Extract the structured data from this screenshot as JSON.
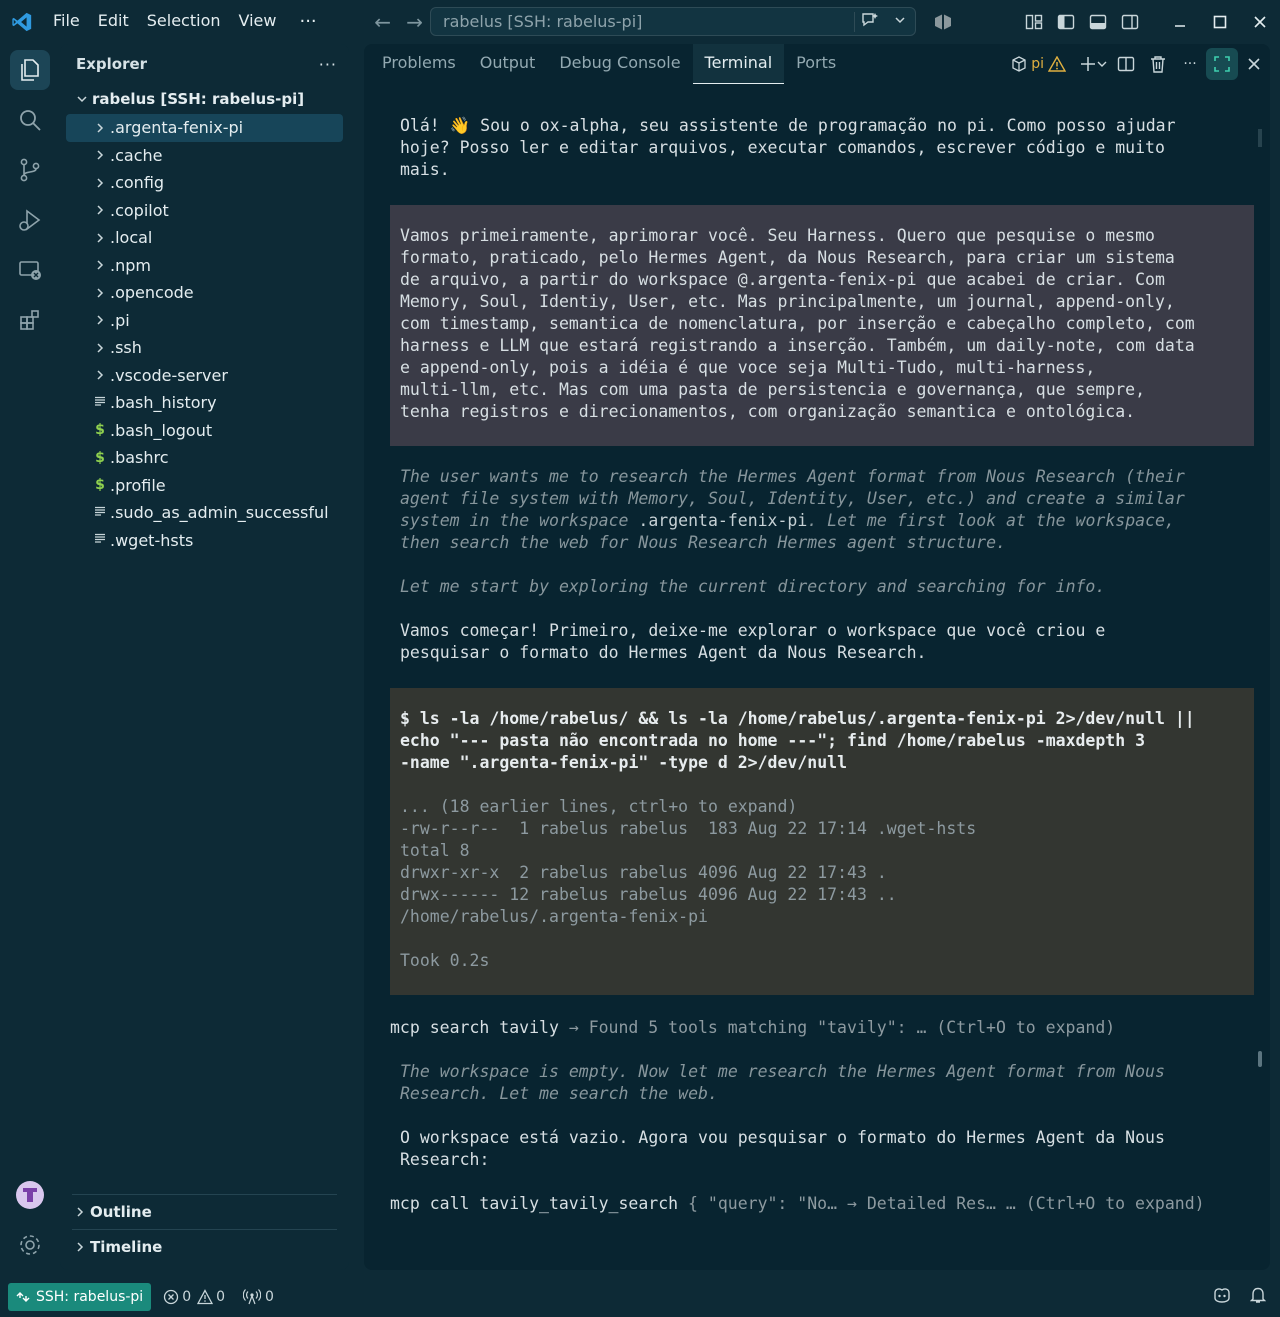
{
  "titlebar": {
    "menus": [
      "File",
      "Edit",
      "Selection",
      "View"
    ],
    "more": "···",
    "command_center": "rabelus [SSH: rabelus-pi]"
  },
  "sidebar": {
    "title": "Explorer",
    "more": "···",
    "root": "rabelus [SSH: rabelus-pi]",
    "items": [
      {
        "label": ".argenta-fenix-pi",
        "kind": "folder"
      },
      {
        "label": ".cache",
        "kind": "folder"
      },
      {
        "label": ".config",
        "kind": "folder"
      },
      {
        "label": ".copilot",
        "kind": "folder"
      },
      {
        "label": ".local",
        "kind": "folder"
      },
      {
        "label": ".npm",
        "kind": "folder"
      },
      {
        "label": ".opencode",
        "kind": "folder"
      },
      {
        "label": ".pi",
        "kind": "folder"
      },
      {
        "label": ".ssh",
        "kind": "folder"
      },
      {
        "label": ".vscode-server",
        "kind": "folder"
      },
      {
        "label": ".bash_history",
        "kind": "text"
      },
      {
        "label": ".bash_logout",
        "kind": "shell"
      },
      {
        "label": ".bashrc",
        "kind": "shell"
      },
      {
        "label": ".profile",
        "kind": "shell"
      },
      {
        "label": ".sudo_as_admin_successful",
        "kind": "text"
      },
      {
        "label": ".wget-hsts",
        "kind": "text"
      }
    ],
    "outline": "Outline",
    "timeline": "Timeline"
  },
  "panel": {
    "tabs": [
      "Problems",
      "Output",
      "Debug Console",
      "Terminal",
      "Ports"
    ],
    "active_tab": "Terminal",
    "terminal_name": "pi"
  },
  "terminal": {
    "greeting": [
      "Olá! 👋 Sou o ox-alpha, seu assistente de programação no pi. Como posso ajudar",
      "hoje? Posso ler e editar arquivos, executar comandos, escrever código e muito",
      "mais."
    ],
    "user_msg": [
      "Vamos primeiramente, aprimorar você. Seu Harness. Quero que pesquise o mesmo",
      "formato, praticado, pelo Hermes Agent, da Nous Research, para criar um sistema",
      "de arquivo, a partir do workspace @.argenta-fenix-pi que acabei de criar. Com",
      "Memory, Soul, Identiy, User, etc. Mas principalmente, um journal, append-only,",
      "com timestamp, semantica de nomenclatura, por inserção e cabeçalho completo, com",
      "harness e LLM que estará registrando a inserção. Também, um daily-note, com data",
      "e append-only, pois a idéia é que voce seja Multi-Tudo, multi-harness,",
      "multi-llm, etc. Mas com uma pasta de persistencia e governança, que sempre,",
      "tenha registros e direcionamentos, com organização semantica e ontológica."
    ],
    "thinking_1a": "The user wants me to research the Hermes Agent format from Nous Research (their",
    "thinking_1b": "agent file system with Memory, Soul, Identity, User, etc.) and create a similar",
    "thinking_1c_pre": "system in the workspace ",
    "thinking_1c_code": ".argenta-fenix-pi",
    "thinking_1c_post": ". Let me first look at the workspace,",
    "thinking_1d": "then search the web for Nous Research Hermes agent structure.",
    "thinking_1e": "Let me start by exploring the current directory and searching for info.",
    "reply_1": [
      "Vamos começar! Primeiro, deixe-me explorar o workspace que você criou e",
      "pesquisar o formato do Hermes Agent da Nous Research."
    ],
    "bash_cmd": [
      "$ ls -la /home/rabelus/ && ls -la /home/rabelus/.argenta-fenix-pi 2>/dev/null ||",
      "echo \"--- pasta não encontrada no home ---\"; find /home/rabelus -maxdepth 3",
      "-name \".argenta-fenix-pi\" -type d 2>/dev/null"
    ],
    "bash_out_dim": "... (18 earlier lines, ctrl+o to expand)",
    "bash_out": [
      "-rw-r--r--  1 rabelus rabelus  183 Aug 22 17:14 .wget-hsts",
      "total 8",
      "drwxr-xr-x  2 rabelus rabelus 4096 Aug 22 17:43 .",
      "drwx------ 12 rabelus rabelus 4096 Aug 22 17:43 ..",
      "/home/rabelus/.argenta-fenix-pi"
    ],
    "bash_took": "Took 0.2s",
    "mcp1_a": "mcp search tavily",
    "mcp1_b": " → Found 5 tools matching \"tavily\": … (Ctrl+O to expand)",
    "thinking_2": [
      "The workspace is empty. Now let me research the Hermes Agent format from Nous",
      "Research. Let me search the web."
    ],
    "reply_2": [
      "O workspace está vazio. Agora vou pesquisar o formato do Hermes Agent da Nous",
      "Research:"
    ],
    "mcp2_a": "mcp call tavily_tavily_search",
    "mcp2_b": " { \"query\": \"No… → Detailed Res… … (Ctrl+O to expand)"
  },
  "statusbar": {
    "remote": "SSH: rabelus-pi",
    "errors": "0",
    "warnings": "0",
    "ports": "0"
  }
}
